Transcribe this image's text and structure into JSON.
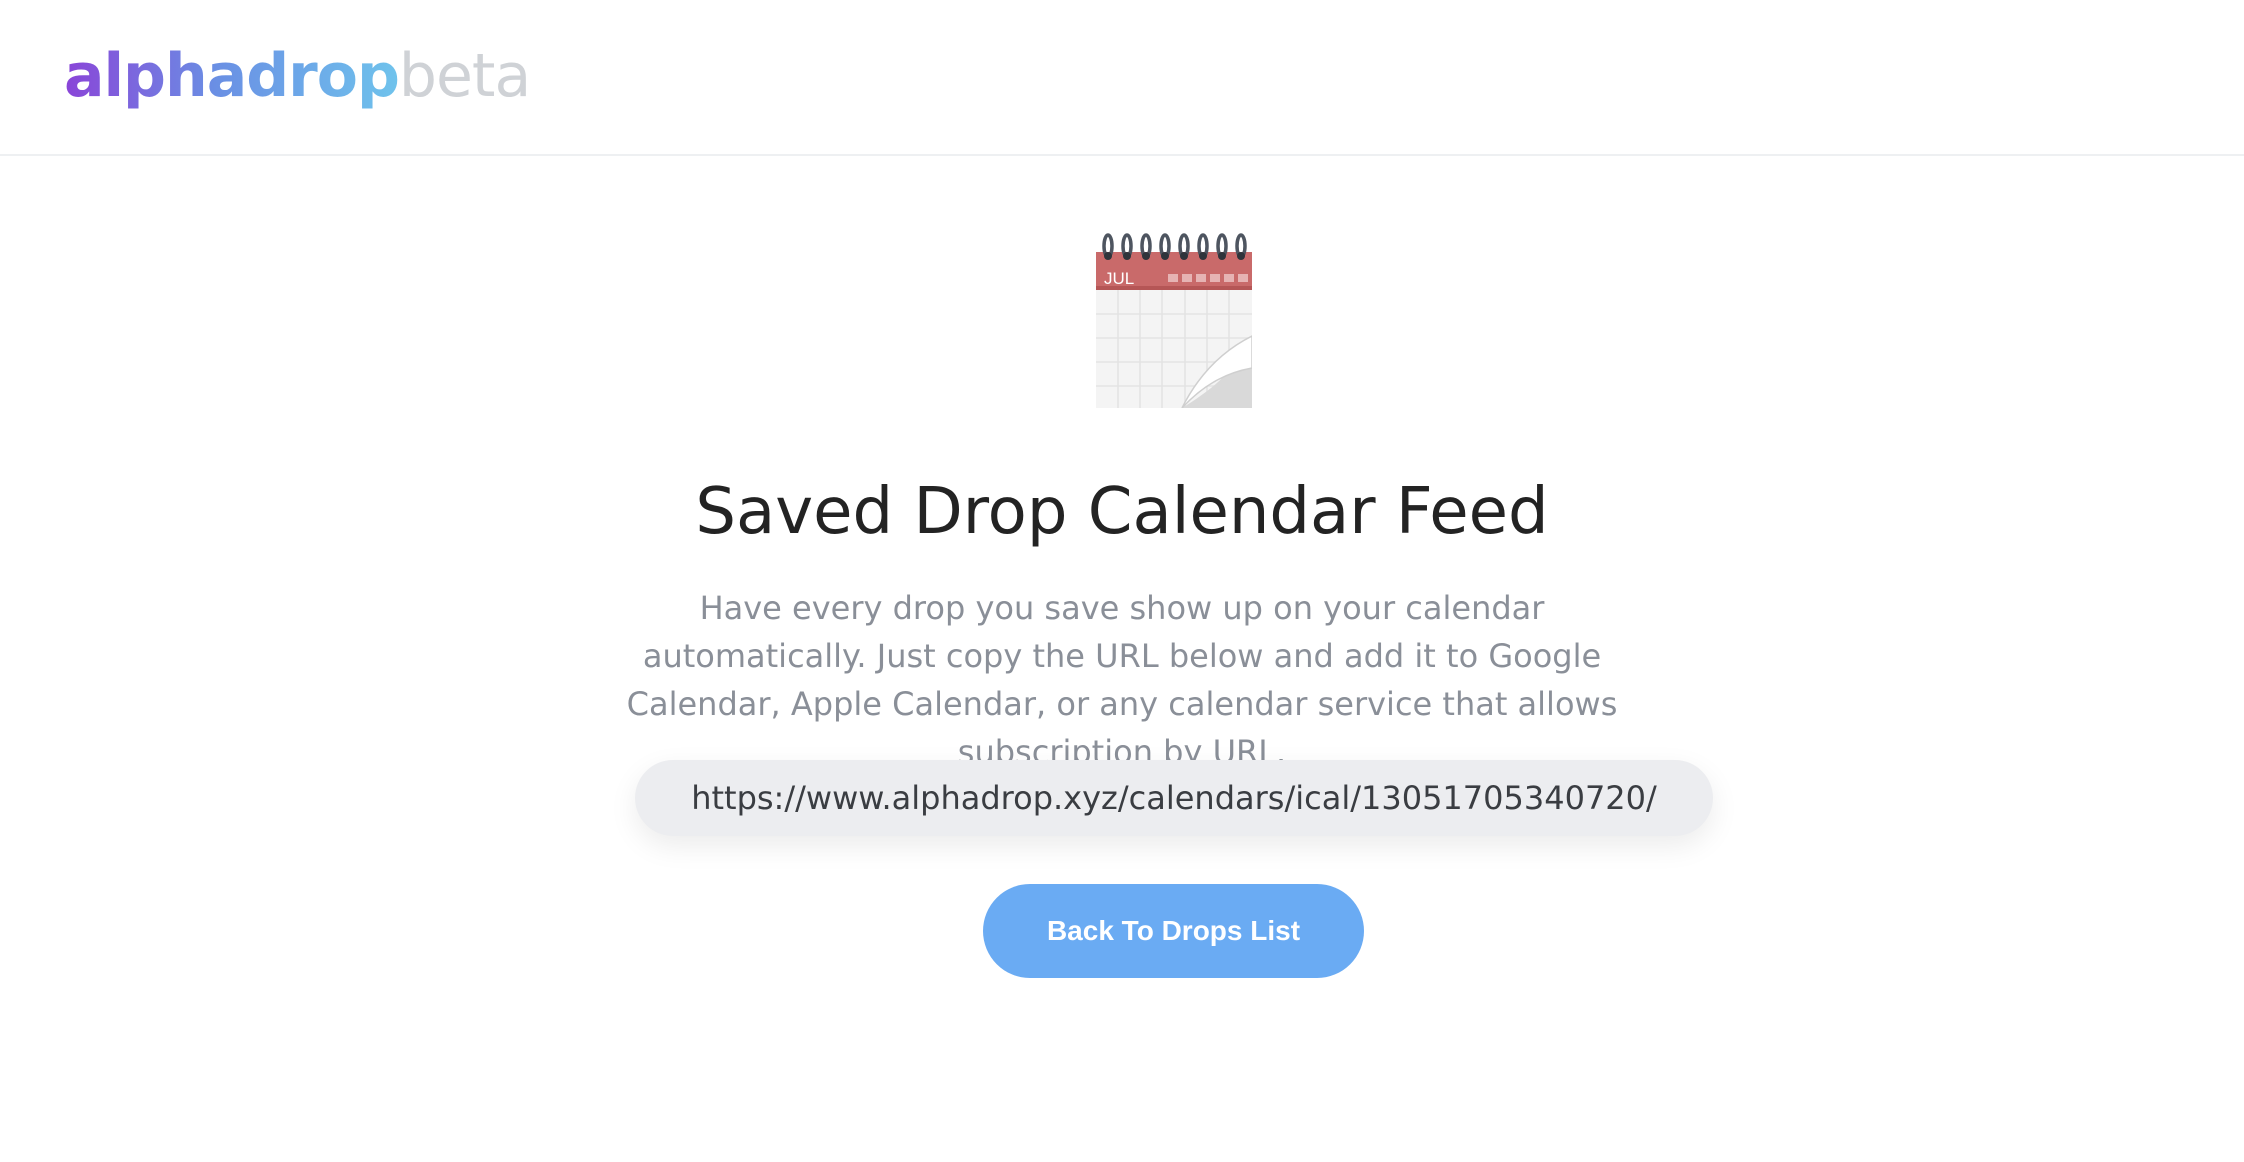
{
  "header": {
    "logo_main": "alphadrop",
    "logo_suffix": "beta"
  },
  "main": {
    "icon": "calendar-icon",
    "calendar_month": "JUL",
    "title": "Saved Drop Calendar Feed",
    "description": "Have every drop you save show up on your calendar automatically. Just copy the URL below and add it to Google Calendar, Apple Calendar, or any calendar service that allows subscription by URL.",
    "feed_url": "https://www.alphadrop.xyz/calendars/ical/13051705340720/",
    "back_button_label": "Back To Drops List"
  },
  "colors": {
    "logo_gradient_start": "#8a44d8",
    "logo_gradient_end": "#6fc3ec",
    "button_bg": "#6aabf3",
    "url_box_bg": "#ecedf0",
    "title_text": "#232323",
    "description_text": "#8a8f98",
    "calendar_header": "#c96a6a"
  }
}
